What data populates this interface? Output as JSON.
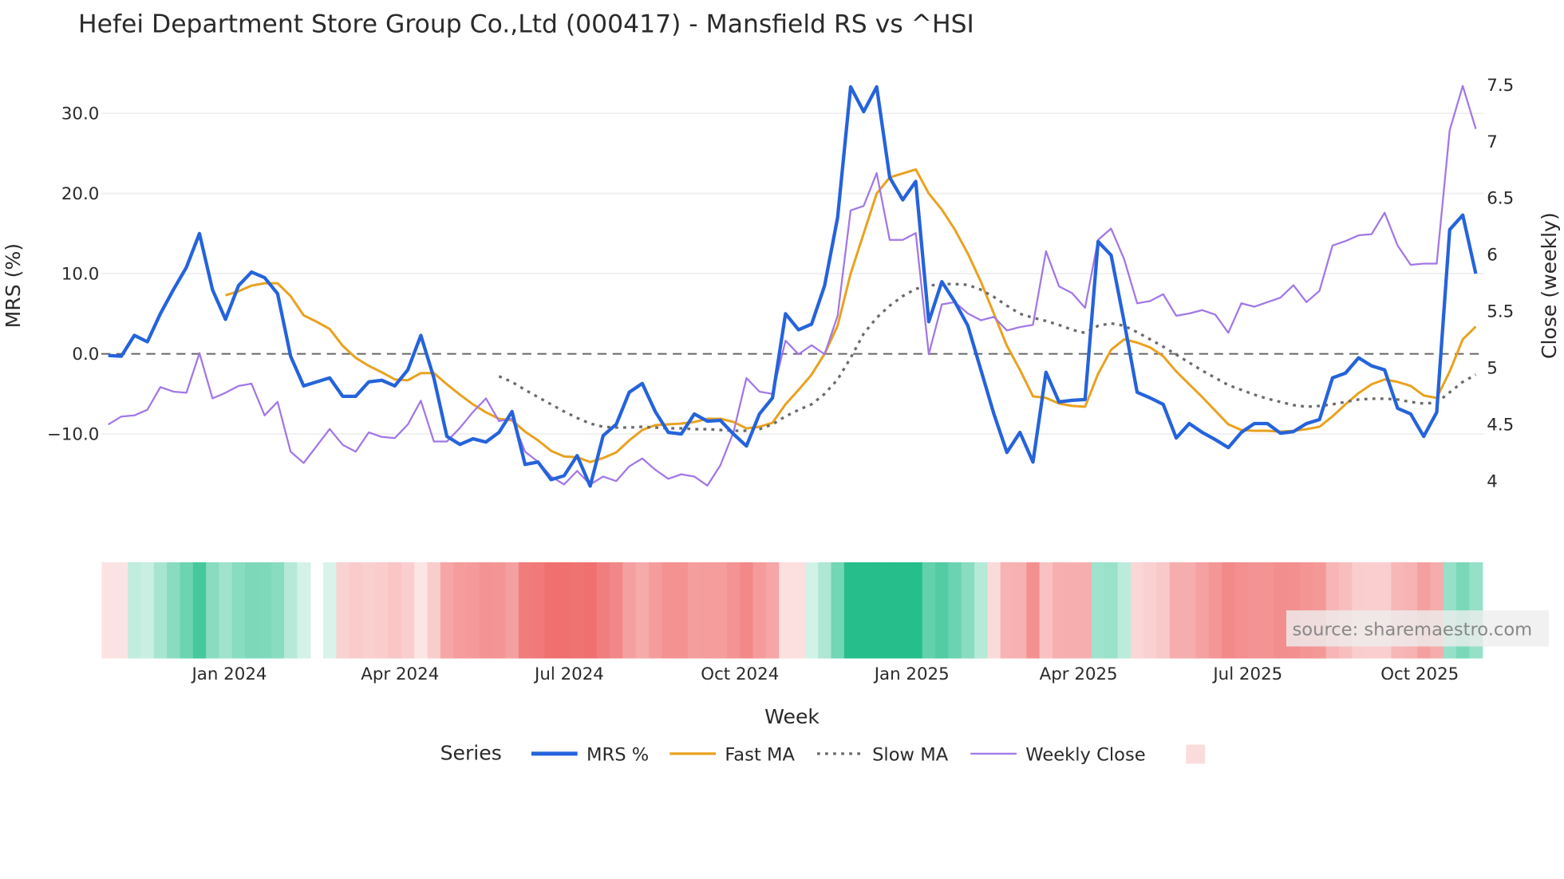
{
  "chart_data": {
    "type": "line",
    "title": "Hefei Department Store Group Co.,Ltd (000417) - Mansfield RS vs ^HSI",
    "xlabel": "Week",
    "ylabel_left": "MRS (%)",
    "ylabel_right": "Close (weekly)",
    "ylim_left": [
      -17.5,
      36
    ],
    "ylim_right": [
      3.73,
      7.73
    ],
    "yticks_left": [
      {
        "v": 30,
        "label": "30.0"
      },
      {
        "v": 20,
        "label": "20.0"
      },
      {
        "v": 10,
        "label": "10.0"
      },
      {
        "v": 0,
        "label": "0.0"
      },
      {
        "v": -10,
        "label": "−10.0"
      }
    ],
    "yticks_right": [
      {
        "v": 7.5,
        "label": "7.5"
      },
      {
        "v": 7,
        "label": "7"
      },
      {
        "v": 6.5,
        "label": "6.5"
      },
      {
        "v": 6,
        "label": "6"
      },
      {
        "v": 5.5,
        "label": "5.5"
      },
      {
        "v": 5,
        "label": "5"
      },
      {
        "v": 4.5,
        "label": "4.5"
      },
      {
        "v": 4,
        "label": "4"
      }
    ],
    "xticks": [
      {
        "week": 9.3,
        "label": "Jan 2024"
      },
      {
        "week": 22.4,
        "label": "Apr 2024"
      },
      {
        "week": 35.4,
        "label": "Jul 2024"
      },
      {
        "week": 48.5,
        "label": "Oct 2024"
      },
      {
        "week": 61.7,
        "label": "Jan 2025"
      },
      {
        "week": 74.5,
        "label": "Apr 2025"
      },
      {
        "week": 87.5,
        "label": "Jul 2025"
      },
      {
        "week": 100.7,
        "label": "Oct 2025"
      }
    ],
    "reference_line": 0,
    "series": [
      {
        "name": "MRS %",
        "color": "#2563db",
        "axis": "left",
        "values": [
          -0.2,
          -0.3,
          2.3,
          1.5,
          5,
          8,
          10.8,
          15,
          8,
          4.3,
          8.5,
          10.2,
          9.5,
          7.5,
          -0.3,
          -4,
          -3.5,
          -3,
          -5.3,
          -5.3,
          -3.5,
          -3.3,
          -4,
          -2,
          2.3,
          -3,
          -10.3,
          -11.3,
          -10.6,
          -11,
          -9.8,
          -7.2,
          -13.8,
          -13.5,
          -15.7,
          -15.2,
          -12.7,
          -16.5,
          -10.2,
          -8.8,
          -4.8,
          -3.7,
          -7.2,
          -9.8,
          -10,
          -7.5,
          -8.4,
          -8.3,
          -10,
          -11.5,
          -7.5,
          -5.5,
          5,
          3,
          3.7,
          8.5,
          17,
          33.3,
          30.2,
          33.3,
          22,
          19.2,
          21.5,
          4,
          9,
          6.5,
          3.5,
          -2,
          -7.5,
          -12.3,
          -9.8,
          -13.5,
          -2.3,
          -6,
          -5.8,
          -5.7,
          14,
          12.3,
          4,
          -4.8,
          -5.5,
          -6.3,
          -10.5,
          -8.7,
          -9.8,
          -10.7,
          -11.7,
          -9.8,
          -8.7,
          -8.7,
          -9.9,
          -9.7,
          -8.7,
          -8.2,
          -3,
          -2.4,
          -0.5,
          -1.5,
          -2,
          -6.8,
          -7.5,
          -10.3,
          -7.3,
          15.5,
          17.3,
          10
        ]
      },
      {
        "name": "Fast MA",
        "color": "#e9a21f",
        "axis": "left",
        "values": [
          7.3,
          7.8,
          8.5,
          8.8,
          8.8,
          7.2,
          4.8,
          4,
          3.1,
          1,
          -0.5,
          -1.5,
          -2.3,
          -3.2,
          -3.3,
          -2.4,
          -2.4,
          -3.8,
          -5.1,
          -6.3,
          -7.3,
          -8.1,
          -8.3,
          -9.7,
          -10.8,
          -12.1,
          -12.8,
          -12.9,
          -13.5,
          -13,
          -12.3,
          -10.8,
          -9.5,
          -8.9,
          -8.8,
          -8.7,
          -8.5,
          -8.1,
          -8.1,
          -8.5,
          -9.3,
          -9.1,
          -8.6,
          -6.3,
          -4.5,
          -2.6,
          0,
          3.5,
          10,
          15,
          20,
          22,
          22.5,
          23,
          20,
          18,
          15.5,
          12.5,
          9,
          5,
          1,
          -2,
          -5.3,
          -5.5,
          -6.2,
          -6.5,
          -6.6,
          -2.5,
          0.5,
          1.8,
          1.4,
          0.8,
          -0.3,
          -2.2,
          -3.8,
          -5.4,
          -7.1,
          -8.8,
          -9.5,
          -9.6,
          -9.6,
          -9.7,
          -9.6,
          -9.4,
          -9.1,
          -7.8,
          -6.3,
          -4.9,
          -3.8,
          -3.2,
          -3.5,
          -4,
          -5.2,
          -5.5,
          -2.2,
          1.8,
          3.4
        ]
      },
      {
        "name": "Slow MA",
        "color": "#6b6b6b",
        "axis": "left",
        "dash": true,
        "values": [
          -2.8,
          -3.5,
          -4.5,
          -5.4,
          -6.3,
          -7.2,
          -8,
          -8.7,
          -9.1,
          -9.2,
          -9.2,
          -9.1,
          -9.2,
          -9.3,
          -9.3,
          -9.4,
          -9.4,
          -9.5,
          -9.6,
          -9.6,
          -9.4,
          -8.8,
          -7.8,
          -7,
          -6.3,
          -5,
          -3.2,
          -0.5,
          2.5,
          4.5,
          6,
          7.2,
          8.1,
          8.5,
          8.7,
          8.7,
          8.6,
          8,
          7.1,
          6,
          5,
          4.5,
          4.1,
          3.6,
          3,
          2.6,
          3.5,
          3.8,
          3.5,
          2.7,
          1.8,
          0.9,
          -0.1,
          -1.1,
          -2.1,
          -3,
          -3.9,
          -4.5,
          -5.1,
          -5.6,
          -6,
          -6.4,
          -6.6,
          -6.5,
          -6.3,
          -6,
          -5.7,
          -5.6,
          -5.6,
          -5.7,
          -6,
          -6.2,
          -6.1,
          -4.8,
          -3.5,
          -2.6
        ]
      },
      {
        "name": "Weekly Close",
        "color": "#a277e6",
        "axis": "right",
        "values": [
          4.5,
          4.57,
          4.58,
          4.63,
          4.83,
          4.79,
          4.78,
          5.13,
          4.73,
          4.78,
          4.84,
          4.86,
          4.58,
          4.7,
          4.26,
          4.16,
          4.31,
          4.46,
          4.32,
          4.26,
          4.43,
          4.39,
          4.38,
          4.5,
          4.71,
          4.35,
          4.35,
          4.47,
          4.61,
          4.73,
          4.53,
          4.55,
          4.26,
          4.17,
          4.04,
          3.97,
          4.09,
          3.97,
          4.04,
          4.0,
          4.13,
          4.2,
          4.1,
          4.02,
          4.06,
          4.04,
          3.96,
          4.14,
          4.43,
          4.91,
          4.79,
          4.77,
          5.24,
          5.12,
          5.2,
          5.12,
          5.46,
          6.39,
          6.43,
          6.72,
          6.13,
          6.13,
          6.19,
          5.12,
          5.56,
          5.58,
          5.48,
          5.42,
          5.45,
          5.33,
          5.36,
          5.38,
          6.03,
          5.72,
          5.66,
          5.53,
          6.13,
          6.23,
          5.96,
          5.57,
          5.59,
          5.65,
          5.46,
          5.48,
          5.51,
          5.47,
          5.31,
          5.57,
          5.54,
          5.58,
          5.62,
          5.73,
          5.58,
          5.68,
          6.08,
          6.12,
          6.17,
          6.18,
          6.37,
          6.08,
          5.91,
          5.92,
          5.92,
          7.1,
          7.49,
          7.11
        ]
      }
    ],
    "heatmap": {
      "missing_week": 16,
      "positive_color": "#26bf8c",
      "negative_color": "#f07070"
    },
    "legend": {
      "title": "Series",
      "placement": "bottom"
    }
  },
  "source_label": "source: sharemaestro.com"
}
